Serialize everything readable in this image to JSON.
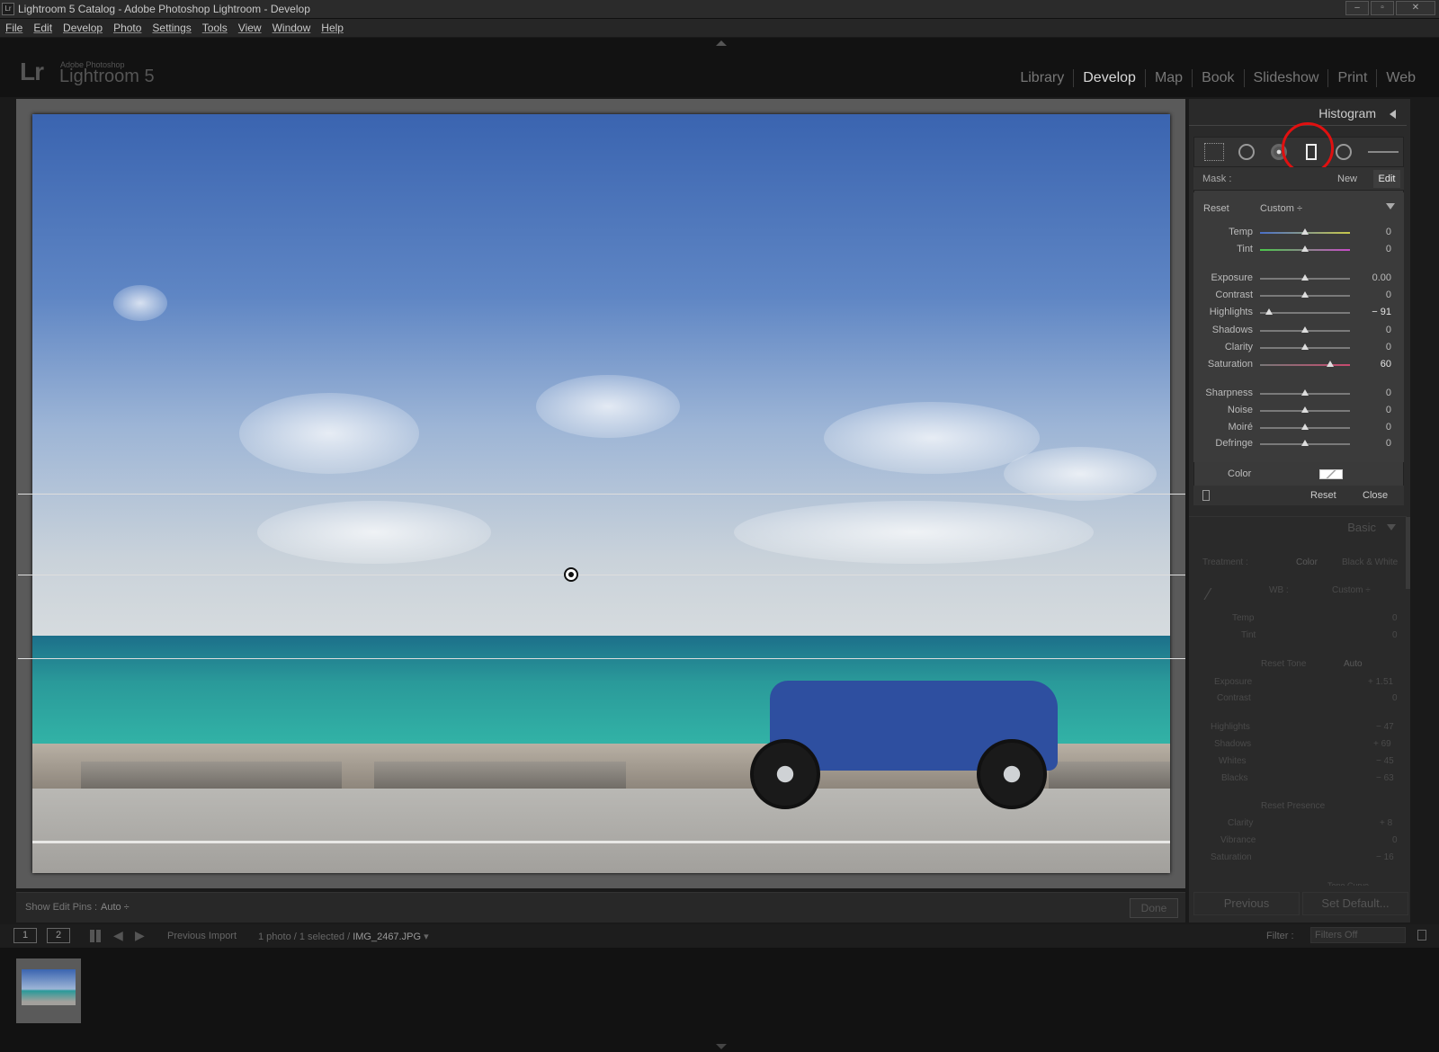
{
  "window": {
    "title": "Lightroom 5 Catalog - Adobe Photoshop Lightroom - Develop",
    "app_icon": "Lr"
  },
  "menu": [
    "File",
    "Edit",
    "Develop",
    "Photo",
    "Settings",
    "Tools",
    "View",
    "Window",
    "Help"
  ],
  "identity": {
    "logo": "Lr",
    "sub": "Adobe Photoshop",
    "product": "Lightroom 5"
  },
  "modules": [
    "Library",
    "Develop",
    "Map",
    "Book",
    "Slideshow",
    "Print",
    "Web"
  ],
  "active_module": "Develop",
  "right_panel": {
    "histogram_label": "Histogram",
    "mask": {
      "label": "Mask :",
      "new": "New",
      "edit": "Edit"
    },
    "effect": {
      "reset": "Reset",
      "preset": "Custom ÷"
    },
    "sliders": [
      {
        "name": "Temp",
        "value": "0",
        "pos": 0.5
      },
      {
        "name": "Tint",
        "value": "0",
        "pos": 0.5
      },
      {
        "name": "Exposure",
        "value": "0.00",
        "pos": 0.5
      },
      {
        "name": "Contrast",
        "value": "0",
        "pos": 0.5
      },
      {
        "name": "Highlights",
        "value": "− 91",
        "pos": 0.1
      },
      {
        "name": "Shadows",
        "value": "0",
        "pos": 0.5
      },
      {
        "name": "Clarity",
        "value": "0",
        "pos": 0.5
      },
      {
        "name": "Saturation",
        "value": "60",
        "pos": 0.78
      },
      {
        "name": "Sharpness",
        "value": "0",
        "pos": 0.5
      },
      {
        "name": "Noise",
        "value": "0",
        "pos": 0.5
      },
      {
        "name": "Moiré",
        "value": "0",
        "pos": 0.5
      },
      {
        "name": "Defringe",
        "value": "0",
        "pos": 0.5
      }
    ],
    "color_label": "Color",
    "footer": {
      "reset": "Reset",
      "close": "Close"
    },
    "basic": {
      "header": "Basic",
      "treatment": "Treatment :",
      "color": "Color",
      "bw": "Black & White",
      "wb": "WB :",
      "wb_value": "Custom ÷",
      "temp": "Temp",
      "temp_val": "0",
      "tint": "Tint",
      "tint_val": "0",
      "tone": "Reset Tone",
      "auto": "Auto",
      "exposure": "Exposure",
      "exposure_val": "+ 1.51",
      "contrast": "Contrast",
      "contrast_val": "0",
      "highlights": "Highlights",
      "highlights_val": "− 47",
      "shadows": "Shadows",
      "shadows_val": "+ 69",
      "whites": "Whites",
      "whites_val": "− 45",
      "blacks": "Blacks",
      "blacks_val": "− 63",
      "presence": "Reset Presence",
      "clarity": "Clarity",
      "clarity_val": "+ 8",
      "vibrance": "Vibrance",
      "vibrance_val": "0",
      "saturation": "Saturation",
      "saturation_val": "− 16",
      "tone_curve": "Tone Curve"
    },
    "buttons": {
      "previous": "Previous",
      "set_default": "Set Default..."
    }
  },
  "toolbar": {
    "pins_label": "Show Edit Pins :",
    "pins_value": "Auto ÷",
    "done": "Done"
  },
  "filmstrip": {
    "monitor1": "1",
    "monitor2": "2",
    "source": "Previous Import",
    "info": "1 photo / 1 selected / ",
    "filename": "IMG_2467.JPG",
    "filter_label": "Filter :",
    "filter_value": "Filters Off"
  },
  "colors": {
    "accent_ring": "#e01010",
    "active_module": "#d8d8d8"
  }
}
